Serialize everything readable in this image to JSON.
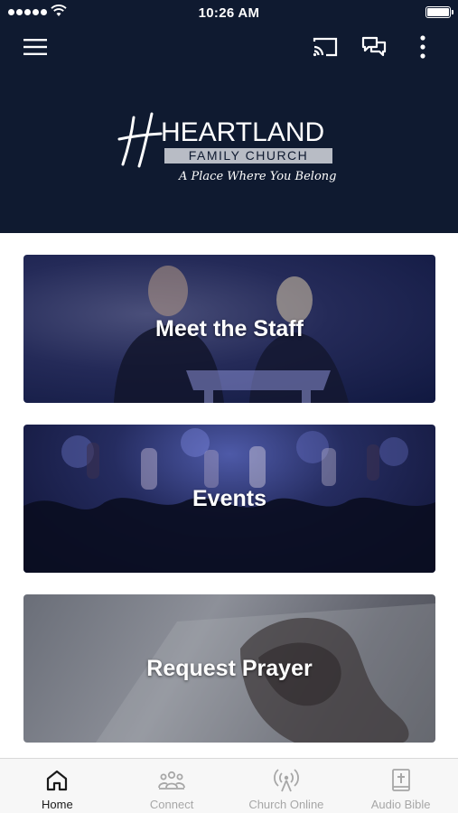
{
  "status_bar": {
    "time": "10:26 AM"
  },
  "header": {
    "logo": {
      "word": "HEARTLAND",
      "subtitle": "FAMILY CHURCH",
      "tagline": "A Place Where You Belong"
    },
    "icons": [
      "menu-icon",
      "cast-icon",
      "chat-icon",
      "more-vertical-icon"
    ]
  },
  "cards": [
    {
      "title": "Meet the Staff"
    },
    {
      "title": "Events"
    },
    {
      "title": "Request Prayer"
    }
  ],
  "nav": [
    {
      "label": "Home",
      "icon": "home-icon",
      "active": true
    },
    {
      "label": "Connect",
      "icon": "people-icon",
      "active": false
    },
    {
      "label": "Church Online",
      "icon": "broadcast-icon",
      "active": false
    },
    {
      "label": "Audio Bible",
      "icon": "bible-icon",
      "active": false
    }
  ],
  "colors": {
    "header_bg": "#0f1a30",
    "nav_active": "#1a1a1a",
    "nav_inactive": "#a7a7a7"
  }
}
